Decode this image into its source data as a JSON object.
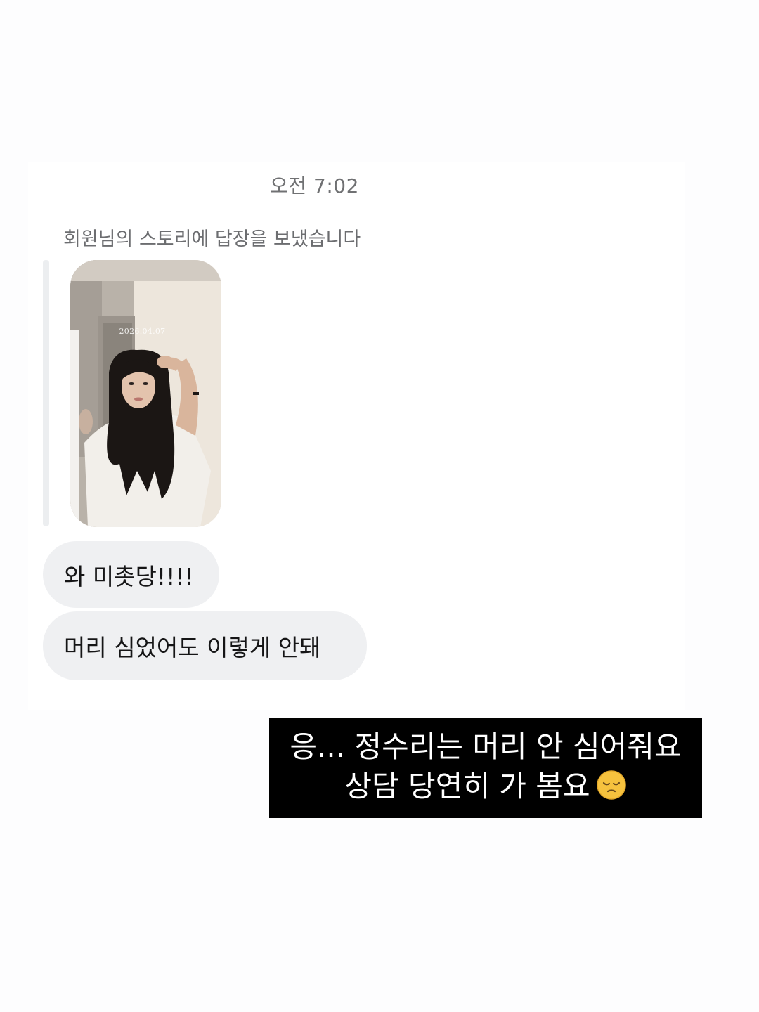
{
  "message_thread": {
    "timestamp": "오전 7:02",
    "reply_notice": "회원님의 스토리에 답장을 보냈습니다",
    "story_preview": {
      "date_overlay": "2026.04.07"
    },
    "messages": [
      {
        "text": "와 미촛당!!!!"
      },
      {
        "text": "머리 심었어도 이렇게 안돼"
      }
    ]
  },
  "caption_overlay": {
    "line_1": "응... 정수리는 머리 안 심어줘요",
    "line_2": "상담 당연히 가 봄요",
    "emoji": "pensive-face-emoji"
  },
  "colors": {
    "bubble_background": "#eff0f2",
    "caption_background": "#000000",
    "caption_text": "#ffffff",
    "meta_text": "#707173"
  }
}
